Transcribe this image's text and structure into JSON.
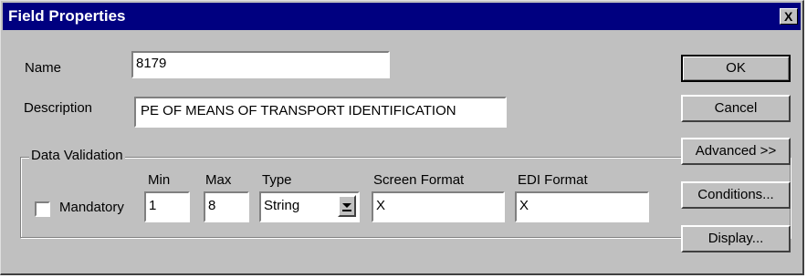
{
  "window": {
    "title": "Field Properties",
    "close_label": "X"
  },
  "form": {
    "name_label": "Name",
    "name_value": "8179",
    "description_label": "Description",
    "description_value": "PE OF MEANS OF TRANSPORT IDENTIFICATION"
  },
  "validation": {
    "group_label": "Data Validation",
    "mandatory_label": "Mandatory",
    "mandatory_checked": false,
    "min_label": "Min",
    "min_value": "1",
    "max_label": "Max",
    "max_value": "8",
    "type_label": "Type",
    "type_value": "String",
    "screen_format_label": "Screen Format",
    "screen_format_value": "X",
    "edi_format_label": "EDI Format",
    "edi_format_value": "X"
  },
  "buttons": {
    "ok": "OK",
    "cancel": "Cancel",
    "advanced": "Advanced >>",
    "conditions": "Conditions...",
    "display": "Display..."
  },
  "icons": {
    "close": "close-icon",
    "dropdown": "chevron-down-icon"
  }
}
